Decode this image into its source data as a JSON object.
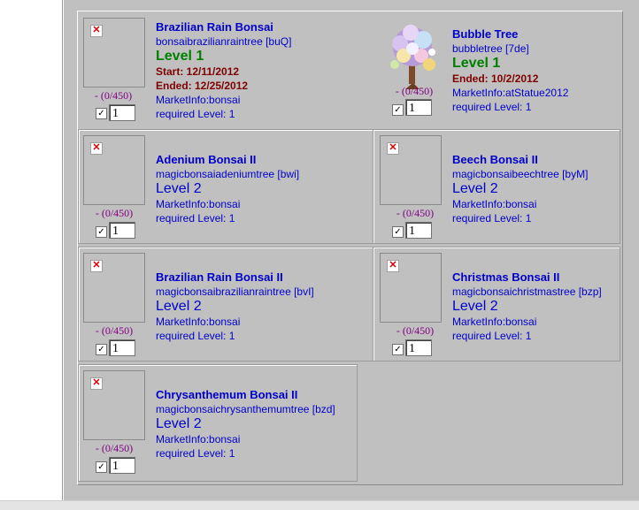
{
  "items": [
    {
      "name": "Brazilian Rain Bonsai",
      "code": "bonsaibrazilianraintree [buQ]",
      "level": "Level 1",
      "start": "Start: 12/11/2012",
      "ended": "Ended: 12/25/2012",
      "market": "MarketInfo:bonsai",
      "required": "required Level: 1",
      "count": "- (0/450)",
      "qty": "1",
      "image": "broken-image-icon"
    },
    {
      "name": "Bubble Tree",
      "code": "bubbletree [7de]",
      "level": "Level 1",
      "ended": "Ended: 10/2/2012",
      "market": "MarketInfo:atStatue2012",
      "required": "required Level: 1",
      "count": "- (0/450)",
      "qty": "1",
      "image": "bubble-tree-icon"
    },
    {
      "name": "Adenium Bonsai II",
      "code": "magicbonsaiadeniumtree [bwi]",
      "level": "Level 2",
      "market": "MarketInfo:bonsai",
      "required": "required Level: 1",
      "count": "- (0/450)",
      "qty": "1",
      "image": "broken-image-icon"
    },
    {
      "name": "Beech Bonsai II",
      "code": "magicbonsaibeechtree [byM]",
      "level": "Level 2",
      "market": "MarketInfo:bonsai",
      "required": "required Level: 1",
      "count": "- (0/450)",
      "qty": "1",
      "image": "broken-image-icon"
    },
    {
      "name": "Brazilian Rain Bonsai II",
      "code": "magicbonsaibrazilianraintree [bvI]",
      "level": "Level 2",
      "market": "MarketInfo:bonsai",
      "required": "required Level: 1",
      "count": "- (0/450)",
      "qty": "1",
      "image": "broken-image-icon"
    },
    {
      "name": "Christmas Bonsai II",
      "code": "magicbonsaichristmastree [bzp]",
      "level": "Level 2",
      "market": "MarketInfo:bonsai",
      "required": "required Level: 1",
      "count": "- (0/450)",
      "qty": "1",
      "image": "broken-image-icon"
    },
    {
      "name": "Chrysanthemum Bonsai II",
      "code": "magicbonsaichrysanthemumtree [bzd]",
      "level": "Level 2",
      "market": "MarketInfo:bonsai",
      "required": "required Level: 1",
      "count": "- (0/450)",
      "qty": "1",
      "image": "broken-image-icon"
    }
  ],
  "colors": {
    "panel": "#c0c0c0",
    "link": "#0000cc",
    "level_new": "#008000",
    "date": "#800000",
    "count": "#800080"
  }
}
